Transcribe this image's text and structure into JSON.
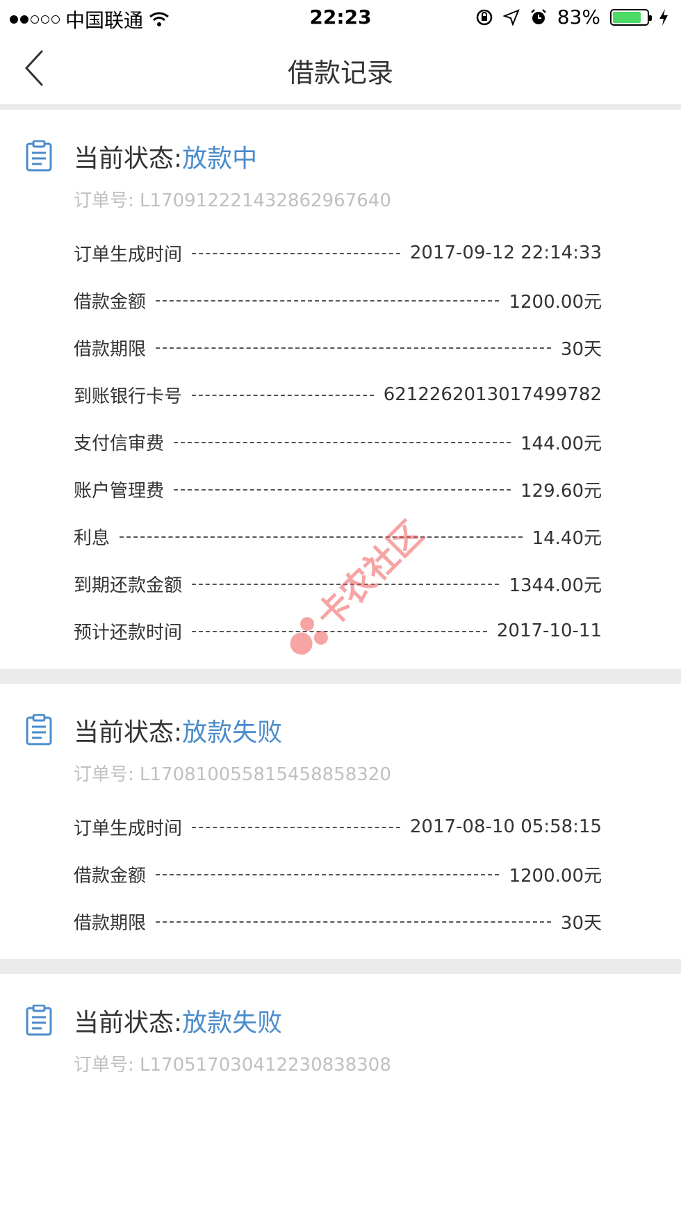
{
  "status_bar": {
    "carrier": "中国联通",
    "time": "22:23",
    "battery": "83%",
    "battery_level": 0.83,
    "colors": {
      "battery_fill": "#4cd964"
    }
  },
  "nav": {
    "title": "借款记录",
    "back_icon": "chevron-left-icon"
  },
  "colors": {
    "accent": "#4a8ccc",
    "muted": "#c0c0c0"
  },
  "watermark_text": "卡农社区",
  "records": [
    {
      "status_label": "当前状态: ",
      "status_value": "放款中",
      "order_no": "订单号: L170912221432862967640",
      "rows": [
        {
          "label": "订单生成时间",
          "value": "2017-09-12 22:14:33"
        },
        {
          "label": "借款金额",
          "value": "1200.00元"
        },
        {
          "label": "借款期限",
          "value": "30天"
        },
        {
          "label": "到账银行卡号",
          "value": "6212262013017499782"
        },
        {
          "label": "支付信审费",
          "value": "144.00元"
        },
        {
          "label": "账户管理费",
          "value": "129.60元"
        },
        {
          "label": "利息",
          "value": "14.40元"
        },
        {
          "label": "到期还款金额",
          "value": "1344.00元"
        },
        {
          "label": "预计还款时间",
          "value": "2017-10-11"
        }
      ]
    },
    {
      "status_label": "当前状态: ",
      "status_value": "放款失败",
      "order_no": "订单号: L170810055815458858320",
      "rows": [
        {
          "label": "订单生成时间",
          "value": "2017-08-10 05:58:15"
        },
        {
          "label": "借款金额",
          "value": "1200.00元"
        },
        {
          "label": "借款期限",
          "value": "30天"
        }
      ]
    },
    {
      "status_label": "当前状态: ",
      "status_value": "放款失败",
      "order_no": "订单号: L170517030412230838308",
      "rows": []
    }
  ]
}
